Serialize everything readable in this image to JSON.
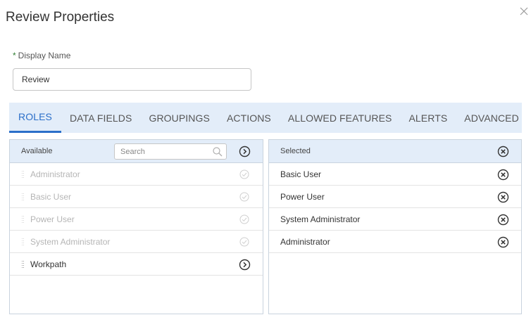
{
  "dialog": {
    "title": "Review Properties",
    "close_icon": "close-icon"
  },
  "display_name": {
    "required_mark": "*",
    "label": "Display Name",
    "value": "Review"
  },
  "tabs": [
    {
      "label": "ROLES",
      "active": true
    },
    {
      "label": "DATA FIELDS",
      "active": false
    },
    {
      "label": "GROUPINGS",
      "active": false
    },
    {
      "label": "ACTIONS",
      "active": false
    },
    {
      "label": "ALLOWED FEATURES",
      "active": false
    },
    {
      "label": "ALERTS",
      "active": false
    },
    {
      "label": "ADVANCED",
      "active": false
    }
  ],
  "available": {
    "title": "Available",
    "search_placeholder": "Search",
    "items": [
      {
        "label": "Administrator",
        "selected": true
      },
      {
        "label": "Basic User",
        "selected": true
      },
      {
        "label": "Power User",
        "selected": true
      },
      {
        "label": "System Administrator",
        "selected": true
      },
      {
        "label": "Workpath",
        "selected": false
      }
    ]
  },
  "selected": {
    "title": "Selected",
    "items": [
      {
        "label": "Basic User"
      },
      {
        "label": "Power User"
      },
      {
        "label": "System Administrator"
      },
      {
        "label": "Administrator"
      }
    ]
  },
  "colors": {
    "accent": "#2b6fc9",
    "header_bg": "#e3edf9",
    "required": "#2e7d32"
  }
}
